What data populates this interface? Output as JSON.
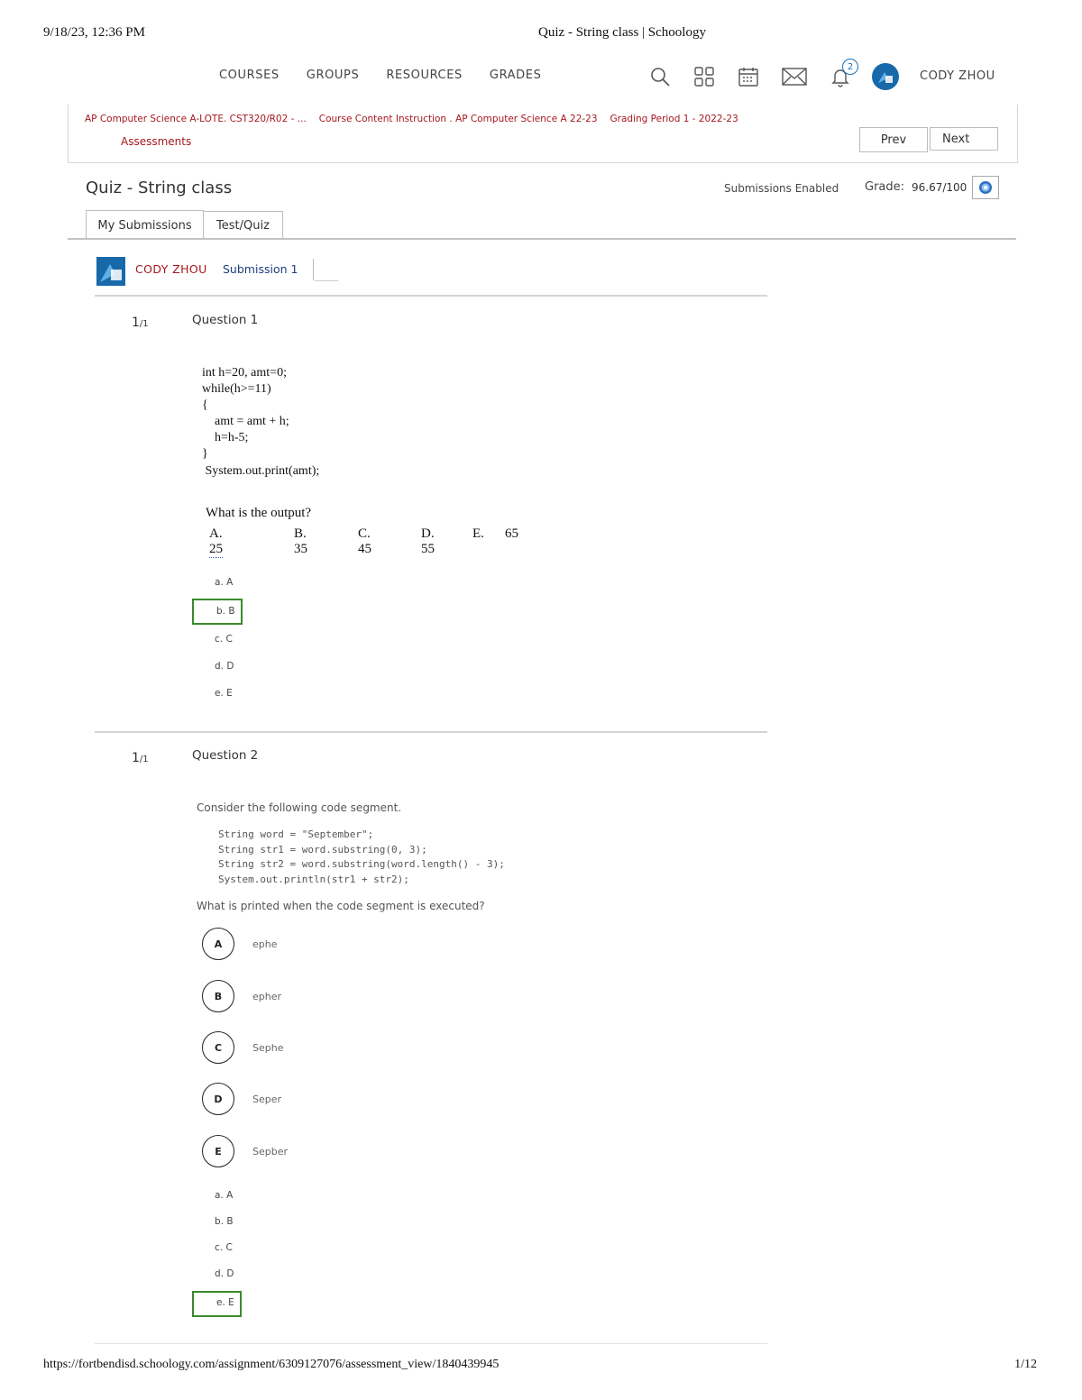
{
  "print": {
    "datetime": "9/18/23, 12:36 PM",
    "doc_title": "Quiz - String class | Schoology",
    "url": "https://fortbendisd.schoology.com/assignment/6309127076/assessment_view/1840439945",
    "page": "1/12"
  },
  "nav": {
    "items": [
      "COURSES",
      "GROUPS",
      "RESOURCES",
      "GRADES"
    ]
  },
  "header_icons": [
    "search-icon",
    "grid-icon",
    "calendar-icon",
    "mail-icon",
    "notification-icon"
  ],
  "notification_count": "2",
  "user": {
    "name": "CODY ZHOU"
  },
  "breadcrumb": {
    "items": [
      "AP Computer Science A-LOTE. CST320/R02 - ...",
      "Course Content Instruction . AP Computer Science A 22-23",
      "Grading Period 1 - 2022-23"
    ],
    "current": "Assessments"
  },
  "buttons": {
    "prev": "Prev",
    "next": "Next"
  },
  "page_title": "Quiz - String class",
  "submissions_status": "Submissions Enabled",
  "grade": {
    "label": "Grade:",
    "value": "96.67/100"
  },
  "tabs": [
    "My Submissions",
    "Test/Quiz"
  ],
  "submission": {
    "student": "CODY ZHOU",
    "selected": "Submission 1"
  },
  "questions": [
    {
      "score": "1",
      "score_max": "/1",
      "label": "Question 1",
      "code": [
        "int h=20, amt=0;",
        "while(h>=11)",
        "{",
        "    amt = amt + h;",
        "    h=h-5;",
        "}",
        " System.out.print(amt);"
      ],
      "prompt": "What is the output?",
      "inline_options": [
        "A. 25",
        "B. 35",
        "C. 45",
        "D. 55",
        "E.",
        "65"
      ],
      "answers": [
        "a. A",
        "b. B",
        "c. C",
        "d. D",
        "e. E"
      ],
      "selected_index": 1
    },
    {
      "score": "1",
      "score_max": "/1",
      "label": "Question 2",
      "intro": "Consider the following code segment.",
      "code": [
        "String word = \"September\";",
        "String str1 = word.substring(0, 3);",
        "String str2 = word.substring(word.length() - 3);",
        "System.out.println(str1 + str2);"
      ],
      "prompt": "What is printed when the code segment is executed?",
      "choices": [
        {
          "letter": "A",
          "text": "ephe"
        },
        {
          "letter": "B",
          "text": "epher"
        },
        {
          "letter": "C",
          "text": "Sephe"
        },
        {
          "letter": "D",
          "text": "Seper"
        },
        {
          "letter": "E",
          "text": "Sepber"
        }
      ],
      "answers": [
        "a. A",
        "b. B",
        "c. C",
        "d. D",
        "e. E"
      ],
      "selected_index": 4
    }
  ],
  "colors": {
    "brand_red": "#a5171d",
    "accent_blue": "#1769aa",
    "selected_green": "#3a8a2a"
  }
}
